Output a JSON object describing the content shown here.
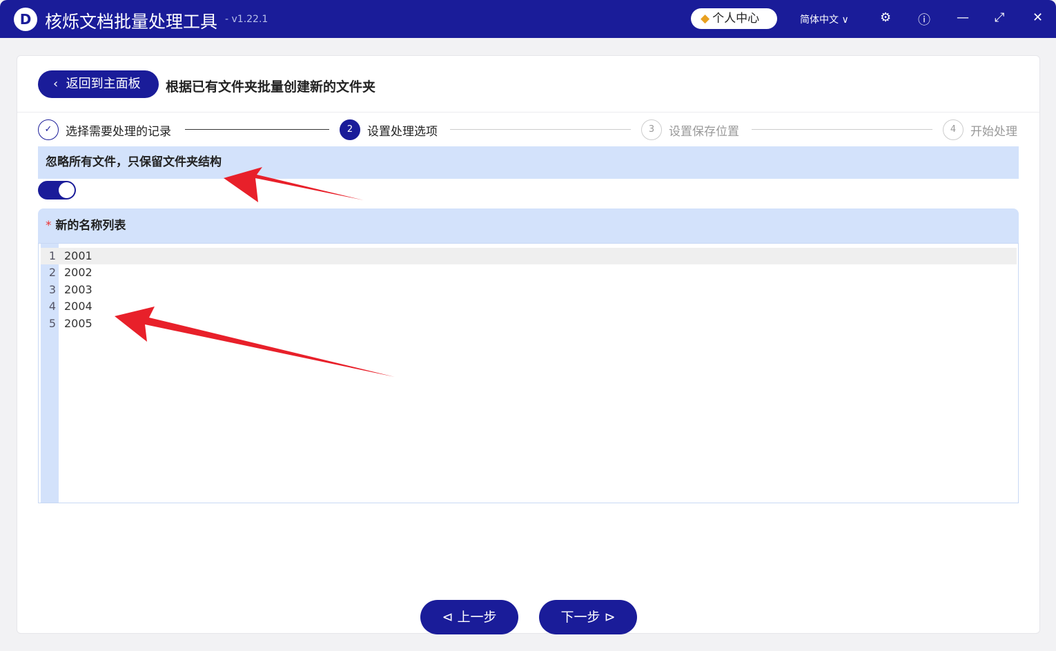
{
  "app": {
    "title": "核烁文档批量处理工具",
    "version": "- v1.22.1",
    "logo": "D"
  },
  "header": {
    "user_center": "个人中心",
    "language": "简体中文"
  },
  "page": {
    "back": "返回到主面板",
    "title": "根据已有文件夹批量创建新的文件夹"
  },
  "steps": [
    {
      "num": "✓",
      "label": "选择需要处理的记录"
    },
    {
      "num": "2",
      "label": "设置处理选项"
    },
    {
      "num": "3",
      "label": "设置保存位置"
    },
    {
      "num": "4",
      "label": "开始处理"
    }
  ],
  "options": {
    "ignore_files_label": "忽略所有文件，只保留文件夹结构",
    "ignore_files_on": true,
    "names_label": "新的名称列表",
    "required_mark": "*"
  },
  "editor": {
    "lines": [
      {
        "n": "1",
        "t": "2001"
      },
      {
        "n": "2",
        "t": "2002"
      },
      {
        "n": "3",
        "t": "2003"
      },
      {
        "n": "4",
        "t": "2004"
      },
      {
        "n": "5",
        "t": "2005"
      }
    ]
  },
  "footer": {
    "prev": "上一步",
    "next": "下一步"
  }
}
